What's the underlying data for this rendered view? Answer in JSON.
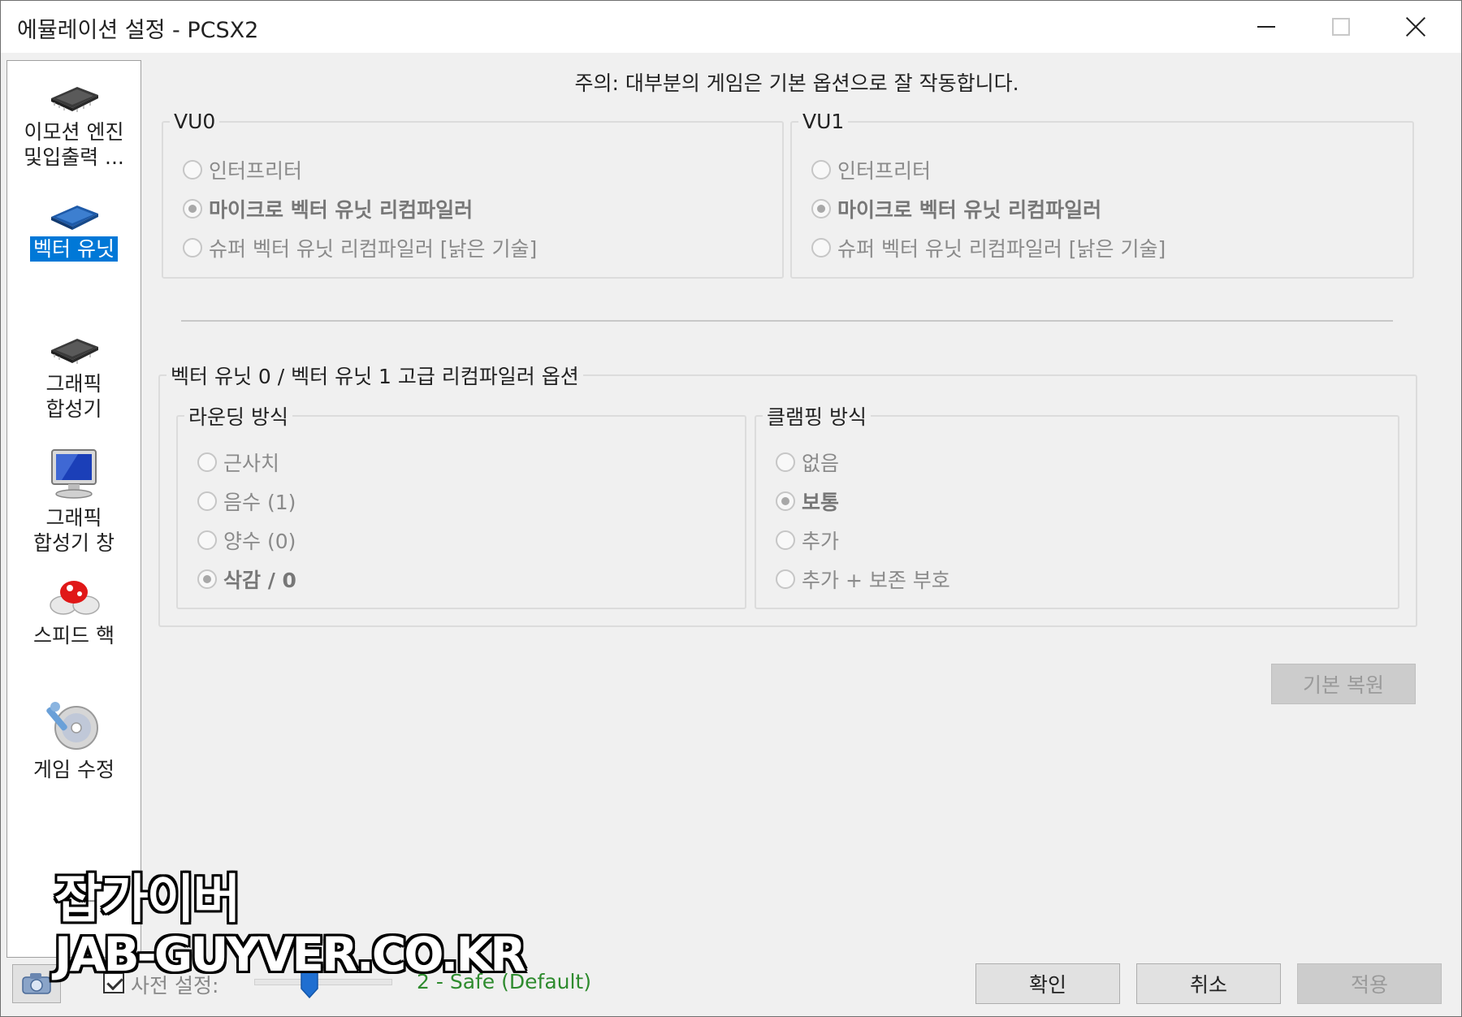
{
  "window": {
    "title": "에뮬레이션 설정 - PCSX2"
  },
  "sidebar": {
    "items": [
      {
        "label_line1": "이모션 엔진",
        "label_line2": "및입출력 ...",
        "icon": "chip-icon"
      },
      {
        "label_line1": "벡터 유닛",
        "label_line2": "",
        "icon": "chip-blue-icon",
        "selected": true
      },
      {
        "label_line1": "그래픽",
        "label_line2": "합성기",
        "icon": "chip-icon"
      },
      {
        "label_line1": "그래픽",
        "label_line2": "합성기 창",
        "icon": "monitor-icon"
      },
      {
        "label_line1": "스피드 핵",
        "label_line2": "",
        "icon": "mushroom-icon"
      },
      {
        "label_line1": "게임 수정",
        "label_line2": "",
        "icon": "disc-wrench-icon"
      }
    ]
  },
  "main": {
    "notice": "주의: 대부분의 게임은 기본 옵션으로 잘 작동합니다.",
    "vu0": {
      "legend": "VU0",
      "options": [
        "인터프리터",
        "마이크로 벡터 유닛 리컴파일러",
        "슈퍼 벡터 유닛 리컴파일러 [낡은 기술]"
      ],
      "selected_index": 1
    },
    "vu1": {
      "legend": "VU1",
      "options": [
        "인터프리터",
        "마이크로 벡터 유닛 리컴파일러",
        "슈퍼 벡터 유닛 리컴파일러 [낡은 기술]"
      ],
      "selected_index": 1
    },
    "advanced": {
      "legend": "벡터 유닛 0 / 벡터 유닛 1 고급 리컴파일러 옵션",
      "rounding": {
        "legend": "라운딩 방식",
        "options": [
          "근사치",
          "음수 (1)",
          "양수 (0)",
          "삭감 / 0"
        ],
        "selected_index": 3
      },
      "clamping": {
        "legend": "클램핑 방식",
        "options": [
          "없음",
          "보통",
          "추가",
          "추가 + 보존 부호"
        ],
        "selected_index": 1
      }
    },
    "restore_default_label": "기본 복원"
  },
  "footer": {
    "preset_label": "사전 설정:",
    "preset_checked": true,
    "preset_value": "2 - Safe (Default)",
    "preset_level": 2,
    "ok_label": "확인",
    "cancel_label": "취소",
    "apply_label": "적용"
  },
  "watermark": {
    "name": "잡가이버",
    "url": "JAB-GUYVER.CO.KR"
  },
  "colors": {
    "selection": "#0078d7",
    "preset_value": "#2e8b2e",
    "window_bg": "#f0f0f0"
  }
}
